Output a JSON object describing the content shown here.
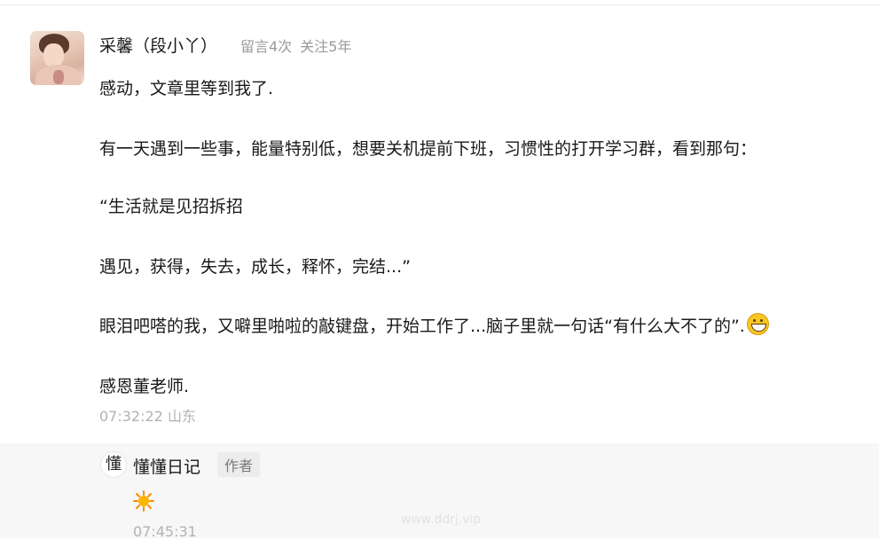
{
  "comment": {
    "username": "采馨（段小丫）",
    "meta": {
      "comment_count": "留言4次",
      "follow_duration": "关注5年"
    },
    "paragraphs": [
      "感动，文章里等到我了.",
      "有一天遇到一些事，能量特别低，想要关机提前下班，习惯性的打开学习群，看到那句：",
      "“生活就是见招拆招",
      "遇见，获得，失去，成长，释怀，完结...”",
      "眼泪吧嗒的我，又噼里啪啦的敲键盘，开始工作了...脑子里就一句话“有什么大不了的”.",
      "感恩董老师."
    ],
    "emoji": "grinning-face-icon",
    "timestamp": "07:32:22 山东"
  },
  "reply": {
    "avatar_char": "懂",
    "author_name": "懂懂日记",
    "badge": "作者",
    "emoji": "sun-icon",
    "timestamp": "07:45:31"
  },
  "watermark": "www.ddrj.vip"
}
